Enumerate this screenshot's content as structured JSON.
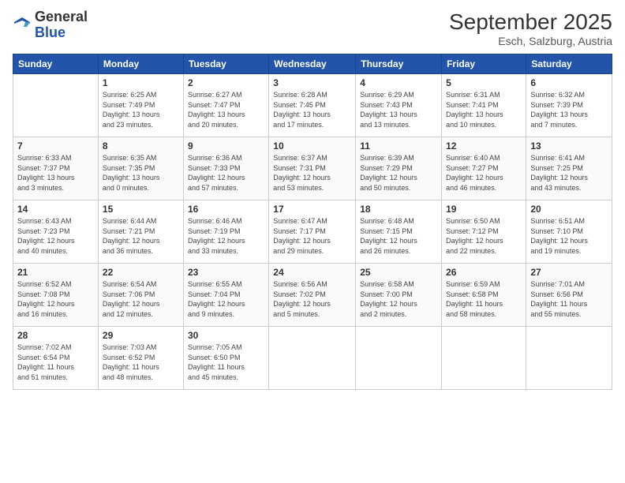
{
  "header": {
    "logo_general": "General",
    "logo_blue": "Blue",
    "month": "September 2025",
    "location": "Esch, Salzburg, Austria"
  },
  "days_of_week": [
    "Sunday",
    "Monday",
    "Tuesday",
    "Wednesday",
    "Thursday",
    "Friday",
    "Saturday"
  ],
  "weeks": [
    [
      {
        "day": "",
        "info": ""
      },
      {
        "day": "1",
        "info": "Sunrise: 6:25 AM\nSunset: 7:49 PM\nDaylight: 13 hours\nand 23 minutes."
      },
      {
        "day": "2",
        "info": "Sunrise: 6:27 AM\nSunset: 7:47 PM\nDaylight: 13 hours\nand 20 minutes."
      },
      {
        "day": "3",
        "info": "Sunrise: 6:28 AM\nSunset: 7:45 PM\nDaylight: 13 hours\nand 17 minutes."
      },
      {
        "day": "4",
        "info": "Sunrise: 6:29 AM\nSunset: 7:43 PM\nDaylight: 13 hours\nand 13 minutes."
      },
      {
        "day": "5",
        "info": "Sunrise: 6:31 AM\nSunset: 7:41 PM\nDaylight: 13 hours\nand 10 minutes."
      },
      {
        "day": "6",
        "info": "Sunrise: 6:32 AM\nSunset: 7:39 PM\nDaylight: 13 hours\nand 7 minutes."
      }
    ],
    [
      {
        "day": "7",
        "info": "Sunrise: 6:33 AM\nSunset: 7:37 PM\nDaylight: 13 hours\nand 3 minutes."
      },
      {
        "day": "8",
        "info": "Sunrise: 6:35 AM\nSunset: 7:35 PM\nDaylight: 13 hours\nand 0 minutes."
      },
      {
        "day": "9",
        "info": "Sunrise: 6:36 AM\nSunset: 7:33 PM\nDaylight: 12 hours\nand 57 minutes."
      },
      {
        "day": "10",
        "info": "Sunrise: 6:37 AM\nSunset: 7:31 PM\nDaylight: 12 hours\nand 53 minutes."
      },
      {
        "day": "11",
        "info": "Sunrise: 6:39 AM\nSunset: 7:29 PM\nDaylight: 12 hours\nand 50 minutes."
      },
      {
        "day": "12",
        "info": "Sunrise: 6:40 AM\nSunset: 7:27 PM\nDaylight: 12 hours\nand 46 minutes."
      },
      {
        "day": "13",
        "info": "Sunrise: 6:41 AM\nSunset: 7:25 PM\nDaylight: 12 hours\nand 43 minutes."
      }
    ],
    [
      {
        "day": "14",
        "info": "Sunrise: 6:43 AM\nSunset: 7:23 PM\nDaylight: 12 hours\nand 40 minutes."
      },
      {
        "day": "15",
        "info": "Sunrise: 6:44 AM\nSunset: 7:21 PM\nDaylight: 12 hours\nand 36 minutes."
      },
      {
        "day": "16",
        "info": "Sunrise: 6:46 AM\nSunset: 7:19 PM\nDaylight: 12 hours\nand 33 minutes."
      },
      {
        "day": "17",
        "info": "Sunrise: 6:47 AM\nSunset: 7:17 PM\nDaylight: 12 hours\nand 29 minutes."
      },
      {
        "day": "18",
        "info": "Sunrise: 6:48 AM\nSunset: 7:15 PM\nDaylight: 12 hours\nand 26 minutes."
      },
      {
        "day": "19",
        "info": "Sunrise: 6:50 AM\nSunset: 7:12 PM\nDaylight: 12 hours\nand 22 minutes."
      },
      {
        "day": "20",
        "info": "Sunrise: 6:51 AM\nSunset: 7:10 PM\nDaylight: 12 hours\nand 19 minutes."
      }
    ],
    [
      {
        "day": "21",
        "info": "Sunrise: 6:52 AM\nSunset: 7:08 PM\nDaylight: 12 hours\nand 16 minutes."
      },
      {
        "day": "22",
        "info": "Sunrise: 6:54 AM\nSunset: 7:06 PM\nDaylight: 12 hours\nand 12 minutes."
      },
      {
        "day": "23",
        "info": "Sunrise: 6:55 AM\nSunset: 7:04 PM\nDaylight: 12 hours\nand 9 minutes."
      },
      {
        "day": "24",
        "info": "Sunrise: 6:56 AM\nSunset: 7:02 PM\nDaylight: 12 hours\nand 5 minutes."
      },
      {
        "day": "25",
        "info": "Sunrise: 6:58 AM\nSunset: 7:00 PM\nDaylight: 12 hours\nand 2 minutes."
      },
      {
        "day": "26",
        "info": "Sunrise: 6:59 AM\nSunset: 6:58 PM\nDaylight: 11 hours\nand 58 minutes."
      },
      {
        "day": "27",
        "info": "Sunrise: 7:01 AM\nSunset: 6:56 PM\nDaylight: 11 hours\nand 55 minutes."
      }
    ],
    [
      {
        "day": "28",
        "info": "Sunrise: 7:02 AM\nSunset: 6:54 PM\nDaylight: 11 hours\nand 51 minutes."
      },
      {
        "day": "29",
        "info": "Sunrise: 7:03 AM\nSunset: 6:52 PM\nDaylight: 11 hours\nand 48 minutes."
      },
      {
        "day": "30",
        "info": "Sunrise: 7:05 AM\nSunset: 6:50 PM\nDaylight: 11 hours\nand 45 minutes."
      },
      {
        "day": "",
        "info": ""
      },
      {
        "day": "",
        "info": ""
      },
      {
        "day": "",
        "info": ""
      },
      {
        "day": "",
        "info": ""
      }
    ]
  ]
}
